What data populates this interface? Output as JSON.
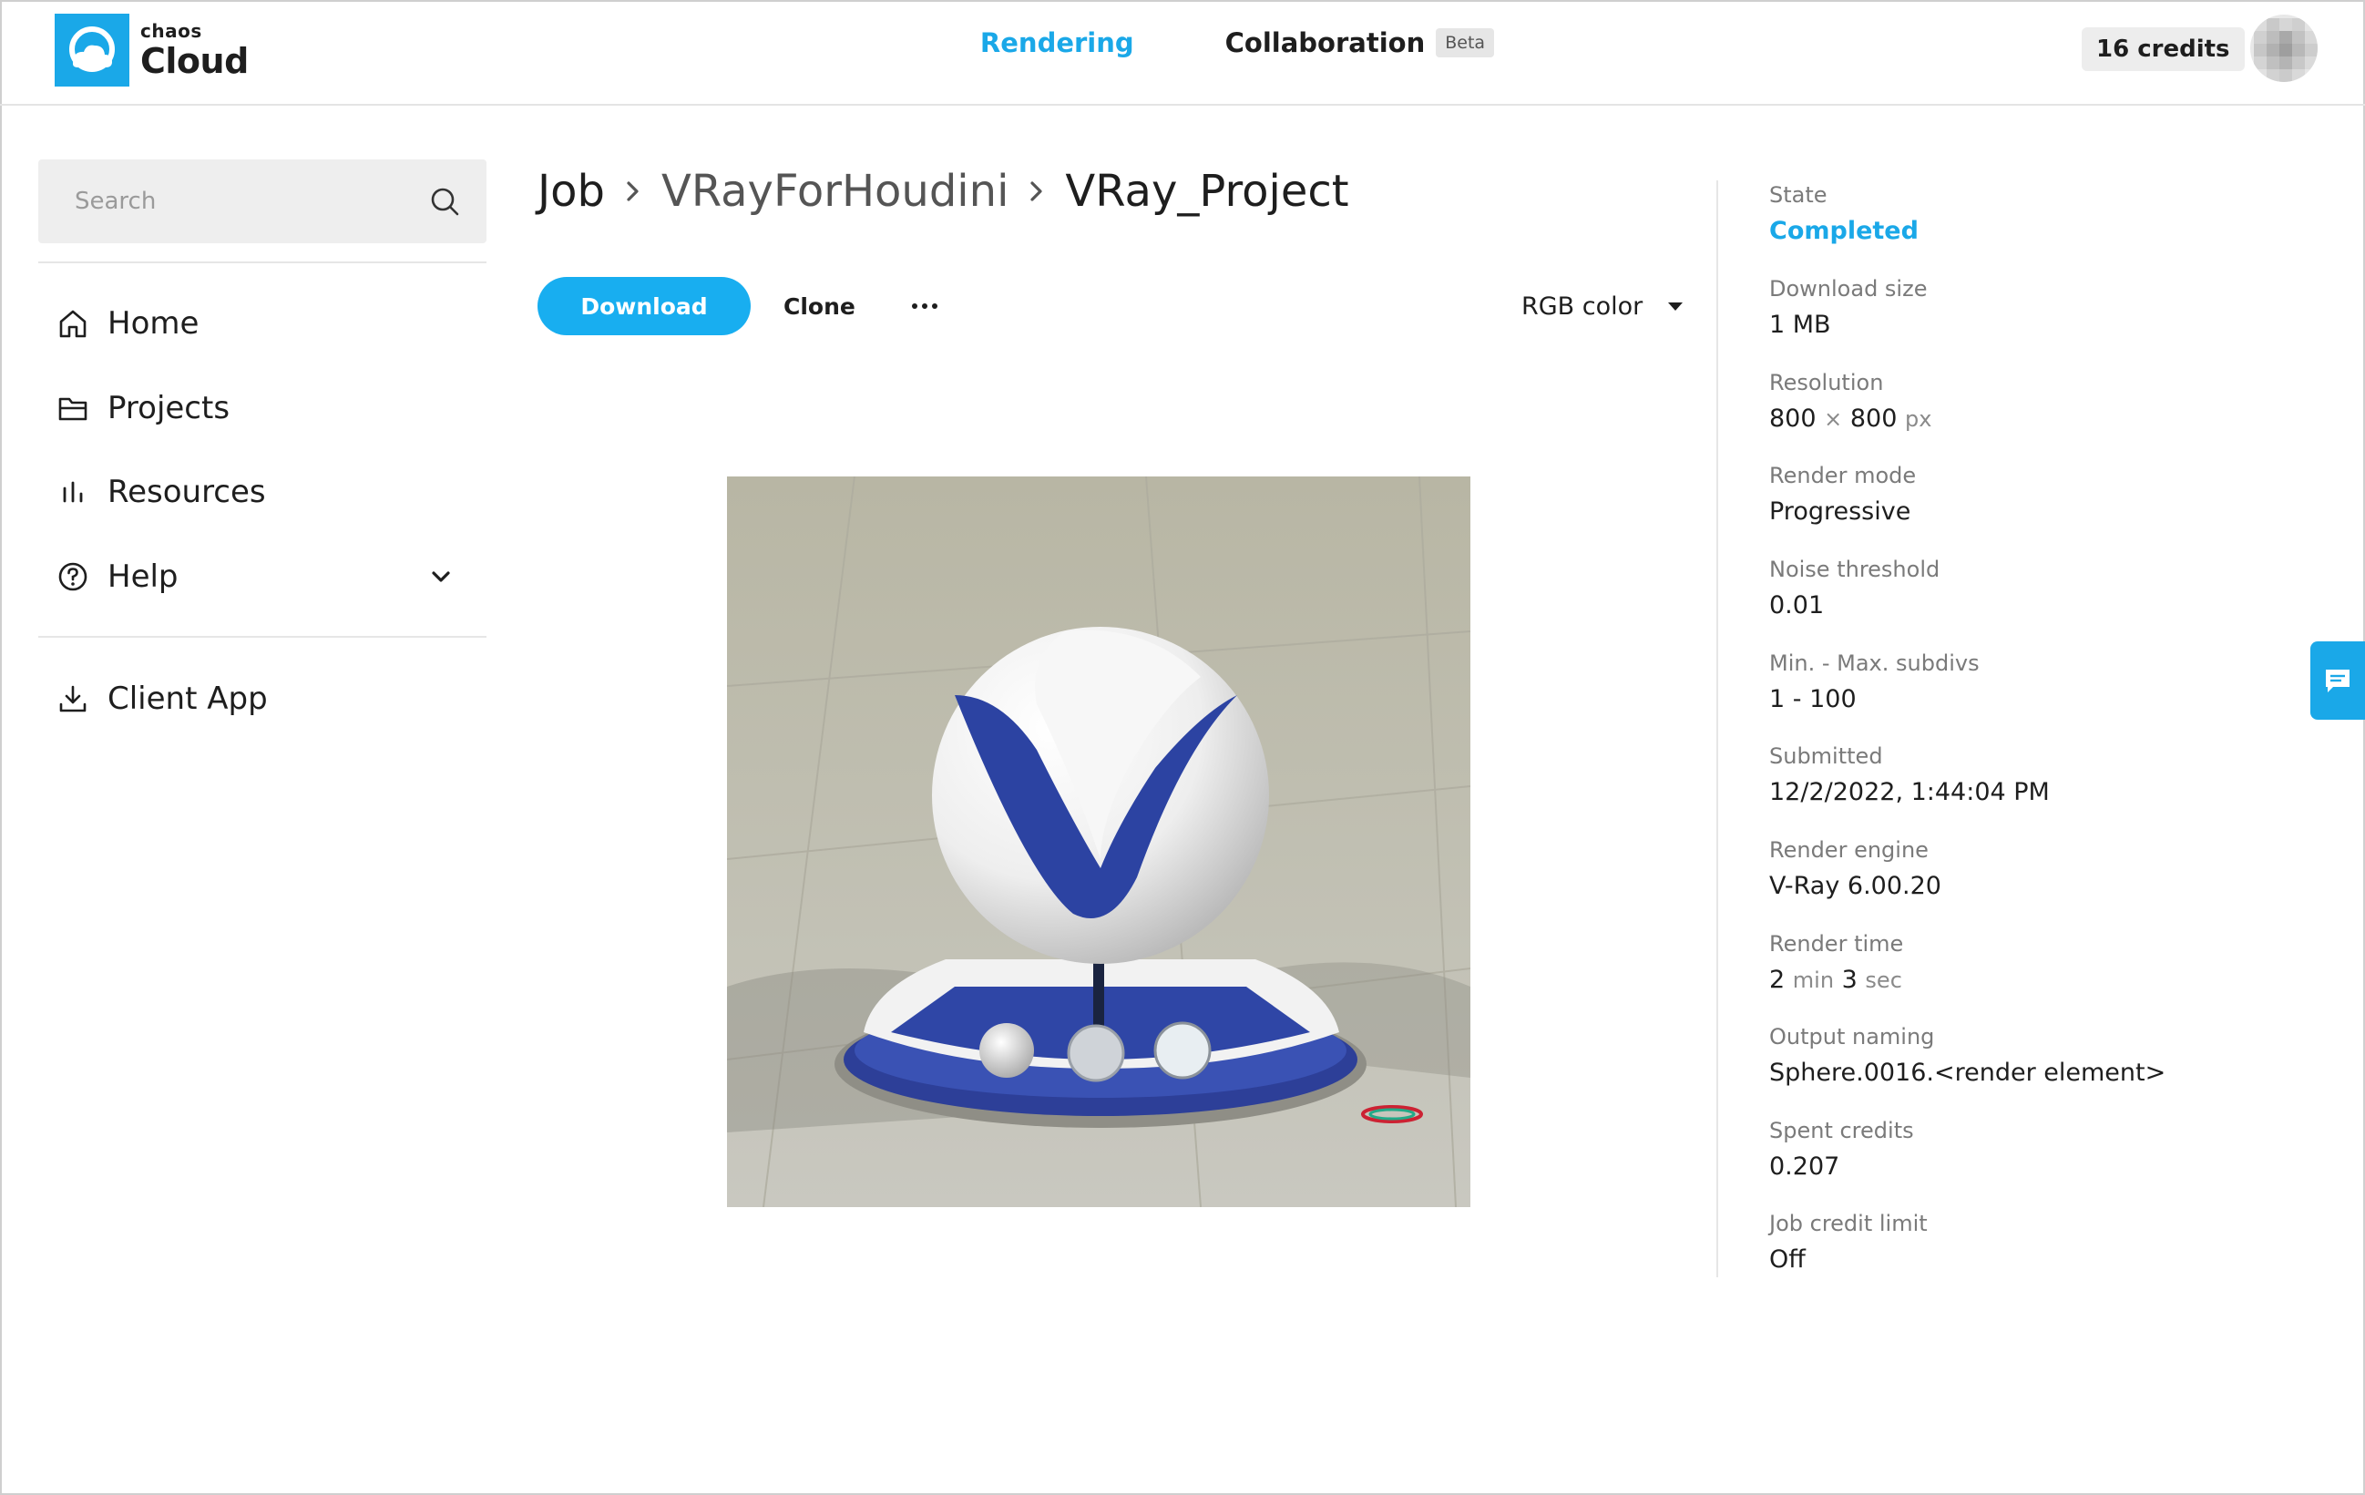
{
  "header": {
    "logo_small": "chaos",
    "logo_big": "Cloud",
    "nav": [
      {
        "label": "Rendering",
        "active": true
      },
      {
        "label": "Collaboration",
        "badge": "Beta",
        "active": false
      }
    ],
    "credits": "16 credits"
  },
  "sidebar": {
    "search_placeholder": "Search",
    "items": [
      {
        "label": "Home",
        "icon": "home-icon"
      },
      {
        "label": "Projects",
        "icon": "folder-icon"
      },
      {
        "label": "Resources",
        "icon": "bar-chart-icon"
      },
      {
        "label": "Help",
        "icon": "help-circle-icon"
      },
      {
        "label": "Client App",
        "icon": "download-icon"
      }
    ]
  },
  "main": {
    "breadcrumb": [
      "Job",
      "VRayForHoudini",
      "VRay_Project"
    ],
    "download_label": "Download",
    "clone_label": "Clone",
    "channel": "RGB color"
  },
  "details": {
    "state_label": "State",
    "state_value": "Completed",
    "size_label": "Download size",
    "size_value": "1 MB",
    "res_label": "Resolution",
    "res_w": "800",
    "res_x": "×",
    "res_h": "800",
    "res_unit": "px",
    "mode_label": "Render mode",
    "mode_value": "Progressive",
    "noise_label": "Noise threshold",
    "noise_value": "0.01",
    "subdivs_label": "Min. - Max. subdivs",
    "subdivs_value": "1 - 100",
    "submitted_label": "Submitted",
    "submitted_value": "12/2/2022, 1:44:04 PM",
    "engine_label": "Render engine",
    "engine_value": "V-Ray 6.00.20",
    "time_label": "Render time",
    "time_min": "2",
    "time_min_unit": "min",
    "time_sec": "3",
    "time_sec_unit": "sec",
    "naming_label": "Output naming",
    "naming_value": "Sphere.0016.<render element>",
    "spent_label": "Spent credits",
    "spent_value": "0.207",
    "limit_label": "Job credit limit",
    "limit_value": "Off"
  },
  "colors": {
    "accent": "#1aa8e8",
    "button": "#18aef0",
    "text": "#1e1e1e",
    "muted": "#7a7a7a"
  }
}
